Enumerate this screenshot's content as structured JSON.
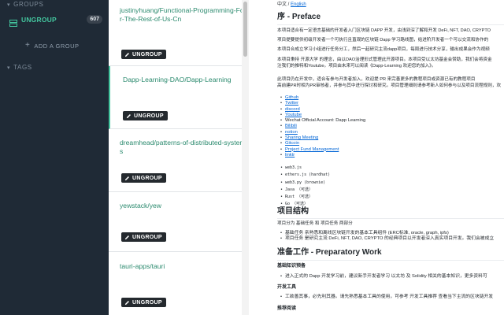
{
  "sidebar": {
    "groups_heading": "GROUPS",
    "ungroup_label": "UNGROUP",
    "ungroup_count": "607",
    "add_group_label": "ADD A GROUP",
    "tags_heading": "TAGS",
    "accent_color": "#43c59e"
  },
  "repos": [
    {
      "name": "justinyhuang/Functional-Programming-For-The-Rest-of-Us-Cn",
      "tag": "UNGROUP"
    },
    {
      "name": "Dapp-Learning-DAO/Dapp-Learning",
      "tag": "UNGROUP"
    },
    {
      "name": "dreamhead/patterns-of-distributed-systems",
      "tag": "UNGROUP"
    },
    {
      "name": "yewstack/yew",
      "tag": "UNGROUP"
    },
    {
      "name": "tauri-apps/tauri",
      "tag": "UNGROUP"
    }
  ],
  "readme": {
    "lang_prefix": "中文 / ",
    "lang_link": "English",
    "preface_title": "序 - Preface",
    "preface_p1": "本项目适合有一定语言基础的开发者入门区块链 DAPP 开发，由浅到深了解和开发 DeFi, NFT, DAO, CRYPTO",
    "preface_p2": "项目提要提供初级开发者一个可执行且直观的区块链 Dapp 学习路线图，给进阶开发者一个可以交流和协作的",
    "preface_p3": "本项目合成立学习小组进行任务分工，然后一起研究主流dapp项目，每周进行技术分享，输出成果会作为视频",
    "preface_p4": "本项目秉持 开源大学 的理念，由以DAO治理形式管理此开源项目。本项目受以太坊基金会赞助，我们会将资金",
    "preface_p5": "注我们的推特和Youtube。项目由未来可以阅读《Dapp-Learning 欢迎您的加入》。",
    "preface_p6": "此项目仍在开发中，适合有参与开发者加入，欢迎提 PR 来完善更多的教程项目或资源已有的教程项目",
    "preface_p7": "高前建PR时相为PR审核者，并参与其中进行探讨和研究。项目管理细则请参考新人如何参与以及项目流程规则，欢",
    "links": [
      "Github",
      "Twitter",
      "discord",
      "Youtube",
      "Wechat Official Account: Dapp Learning",
      "Bilibili",
      "notion",
      "Sharing Meeting",
      "Gitcoin",
      "Project Fund Management",
      "linktr"
    ],
    "tools": [
      "web3.js",
      "ethers.js (hardhat)",
      "web3.py (brownie)",
      "Java （可选）",
      "Rust （可选）",
      "Go （可选）"
    ],
    "structure_title": "项目结构",
    "structure_p": "项目分为 基础任务 和 项目任务 两部分",
    "structure_items": [
      "基础任务 亲熟悉和离线区块链开发的基本工具组件 (ERC标准, oracle, graph, ipfs)",
      "项目任务 是研究主流 DeFi, NFT, DAO, CRYPTO 的经典项目以开发者深入真实项目开发。我们会被成立"
    ],
    "prep_title": "准备工作 - Preparatory Work",
    "knowledge_title": "基础知识预备",
    "knowledge_item": "进入正式的 Dapp 开发学习前，建议新手开发者学习 以太坊 及 Solidity 相关的基本知识，更多资料可",
    "tools_title": "开发工具",
    "tools_item": "工欲善其事，必先利其器。请先熟悉基本工具的使用，可参考 开发工具推荐 查看当下主流的区块链开发",
    "reading_title": "推荐阅读"
  }
}
